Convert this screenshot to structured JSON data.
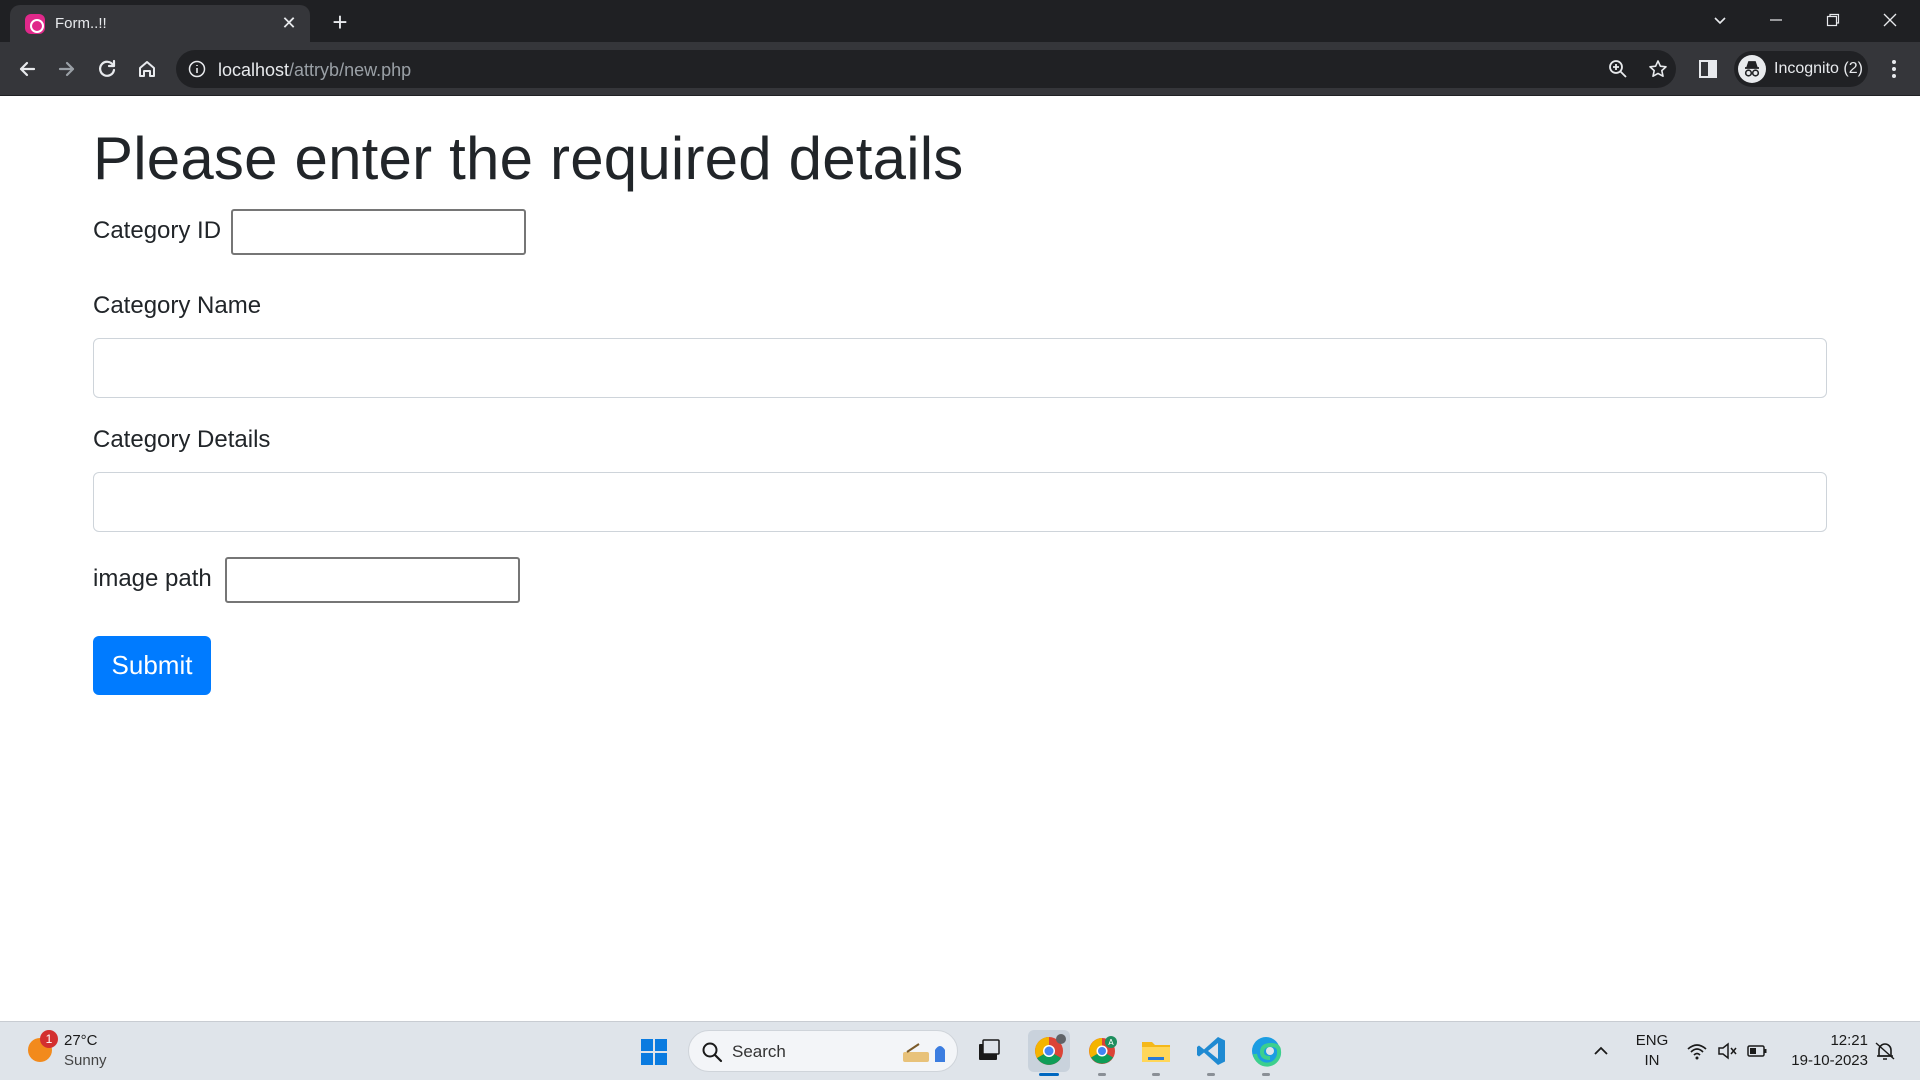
{
  "browser": {
    "tab_title": "Form..!!",
    "url_host": "localhost",
    "url_path": "/attryb/new.php",
    "profile_label": "Incognito (2)"
  },
  "form": {
    "heading": "Please enter the required details",
    "category_id_label": "Category ID",
    "category_id_value": "",
    "category_name_label": "Category Name",
    "category_name_value": "",
    "category_details_label": "Category Details",
    "category_details_value": "",
    "image_path_label": "image path",
    "image_path_value": "",
    "submit_label": "Submit"
  },
  "taskbar": {
    "weather_badge": "1",
    "weather_temp": "27°C",
    "weather_desc": "Sunny",
    "search_placeholder": "Search",
    "lang_line1": "ENG",
    "lang_line2": "IN",
    "time": "12:21",
    "date": "19-10-2023"
  },
  "colors": {
    "primary_button": "#007bff",
    "chrome_dark": "#35363a",
    "tabstrip": "#1f2023"
  },
  "icons": [
    "favicon-icon",
    "close-icon",
    "plus-icon",
    "back-icon",
    "forward-icon",
    "reload-icon",
    "home-icon",
    "info-icon",
    "zoom-icon",
    "star-icon",
    "sidepanel-icon",
    "incognito-icon",
    "menu-icon",
    "windows-start-icon",
    "search-icon",
    "task-view-icon",
    "chrome-icon",
    "file-explorer-icon",
    "vscode-icon",
    "edge-icon",
    "wifi-icon",
    "mute-icon",
    "battery-icon",
    "notification-icon",
    "chevron-up-icon"
  ]
}
